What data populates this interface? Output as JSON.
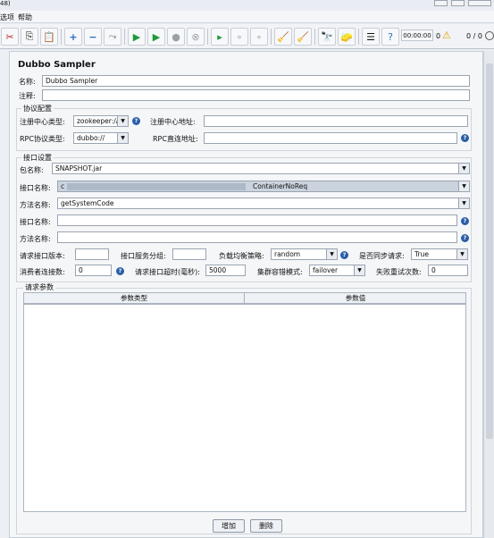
{
  "window": {
    "title_fragment": "48)"
  },
  "menu": {
    "items": [
      "选项",
      "帮助"
    ]
  },
  "toolbar": {
    "timer": "00:00:00",
    "warn_count": "0",
    "threads": "0 / 0"
  },
  "sampler": {
    "heading": "Dubbo Sampler",
    "name_label": "名称:",
    "name_value": "Dubbo Sampler",
    "comment_label": "注释:",
    "comment_value": ""
  },
  "protocol": {
    "legend": "协议配置",
    "registry_type_label": "注册中心类型:",
    "registry_type_value": "zookeeper://",
    "registry_addr_label": "注册中心地址:",
    "registry_addr_value": "",
    "rpc_type_label": "RPC协议类型:",
    "rpc_type_value": "dubbo://",
    "rpc_direct_label": "RPC直连地址:",
    "rpc_direct_value": ""
  },
  "iface": {
    "legend": "接口设置",
    "package_label": "包名称:",
    "package_value": "SNAPSHOT.jar",
    "interface_label": "接口名称:",
    "interface_value_prefix": "c",
    "interface_value_suffix": "ContainerNoReq",
    "method_label": "方法名称:",
    "method_value": "getSystemCode",
    "interface2_label": "接口名称:",
    "method2_label": "方法名称:",
    "version_label": "请求接口版本:",
    "version_value": "",
    "group_label": "接口服务分组:",
    "group_value": "",
    "lb_label": "负载均衡策略:",
    "lb_value": "random",
    "async_label": "是否同步请求:",
    "async_value": "True",
    "conn_label": "消费者连接数:",
    "conn_value": "0",
    "timeout_label": "请求接口超时(毫秒):",
    "timeout_value": "5000",
    "cluster_label": "集群容错模式:",
    "cluster_value": "failover",
    "retries_label": "失败重试次数:",
    "retries_value": "0"
  },
  "params": {
    "legend": "请求参数",
    "col_type": "参数类型",
    "col_value": "参数值",
    "add_label": "增加",
    "delete_label": "删除"
  }
}
